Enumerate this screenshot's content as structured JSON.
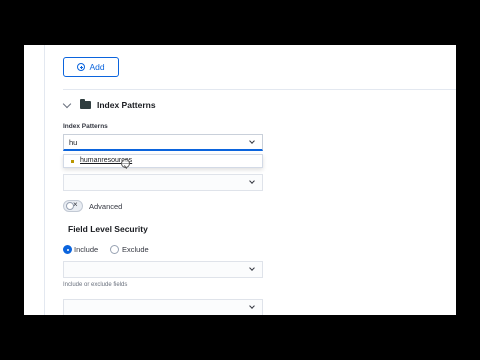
{
  "toolbar": {
    "add_label": "Add"
  },
  "section": {
    "title": "Index Patterns"
  },
  "index_patterns": {
    "label": "Index Patterns",
    "value": "hu",
    "suggestion": "humanresources"
  },
  "advanced": {
    "label": "Advanced",
    "enabled": false
  },
  "field_level_security": {
    "title": "Field Level Security",
    "include_label": "Include",
    "exclude_label": "Exclude",
    "selected": "Include",
    "help_text": "Include or exclude fields"
  },
  "icons": {
    "add": "plus-circle-icon",
    "collapse": "chevron-down-icon",
    "section": "folder-icon",
    "dropdown": "chevron-down-icon",
    "toggle_off": "cross-icon"
  },
  "colors": {
    "accent": "#0b64dd",
    "suggestion_marker": "#b99700"
  }
}
